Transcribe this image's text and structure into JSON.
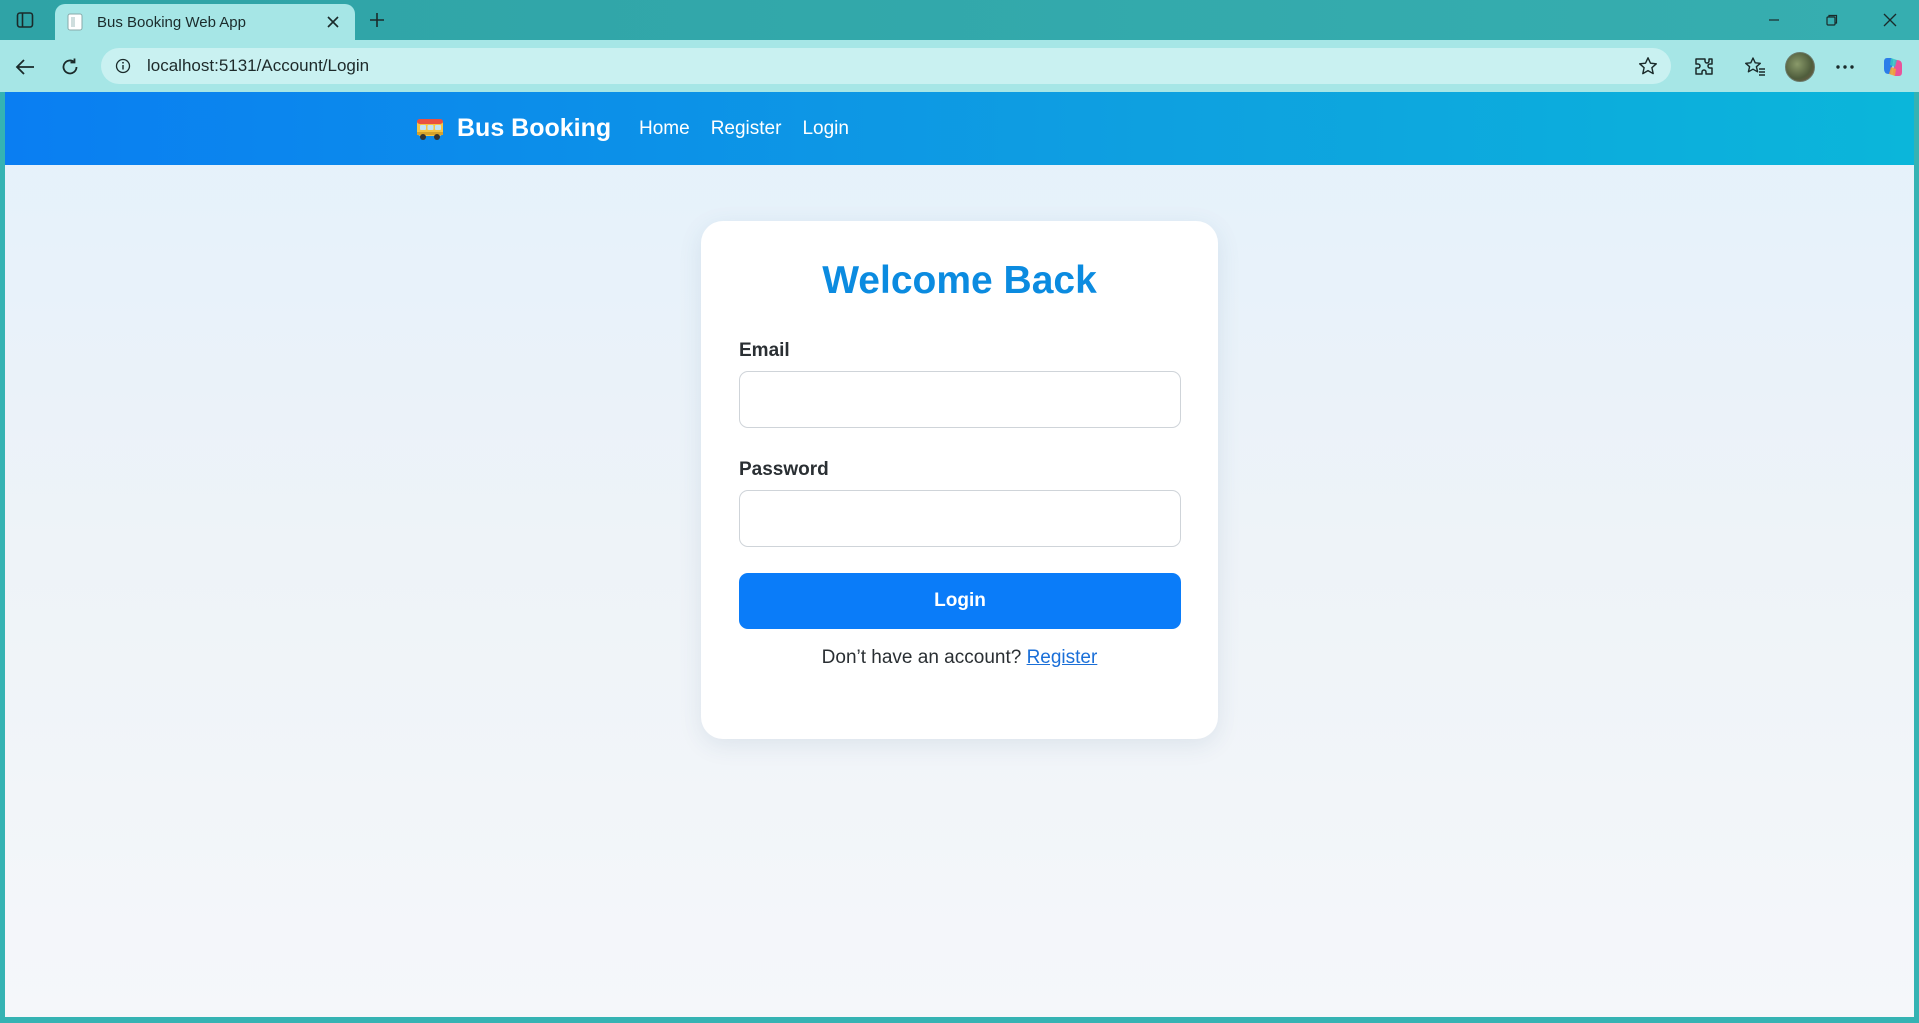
{
  "browser": {
    "tab_title": "Bus Booking Web App",
    "url": "localhost:5131/Account/Login"
  },
  "site": {
    "brand": "Bus Booking",
    "nav": [
      "Home",
      "Register",
      "Login"
    ]
  },
  "login_form": {
    "title": "Welcome Back",
    "email_label": "Email",
    "email_value": "",
    "password_label": "Password",
    "password_value": "",
    "submit_label": "Login",
    "register_prompt": "Don’t have an account?",
    "register_link": "Register"
  },
  "colors": {
    "nav_gradient_start": "#0a7ef2",
    "nav_gradient_end": "#0bb6da",
    "title": "#0b8be0",
    "primary_button": "#0a7cf9",
    "link": "#1a6fd8"
  }
}
